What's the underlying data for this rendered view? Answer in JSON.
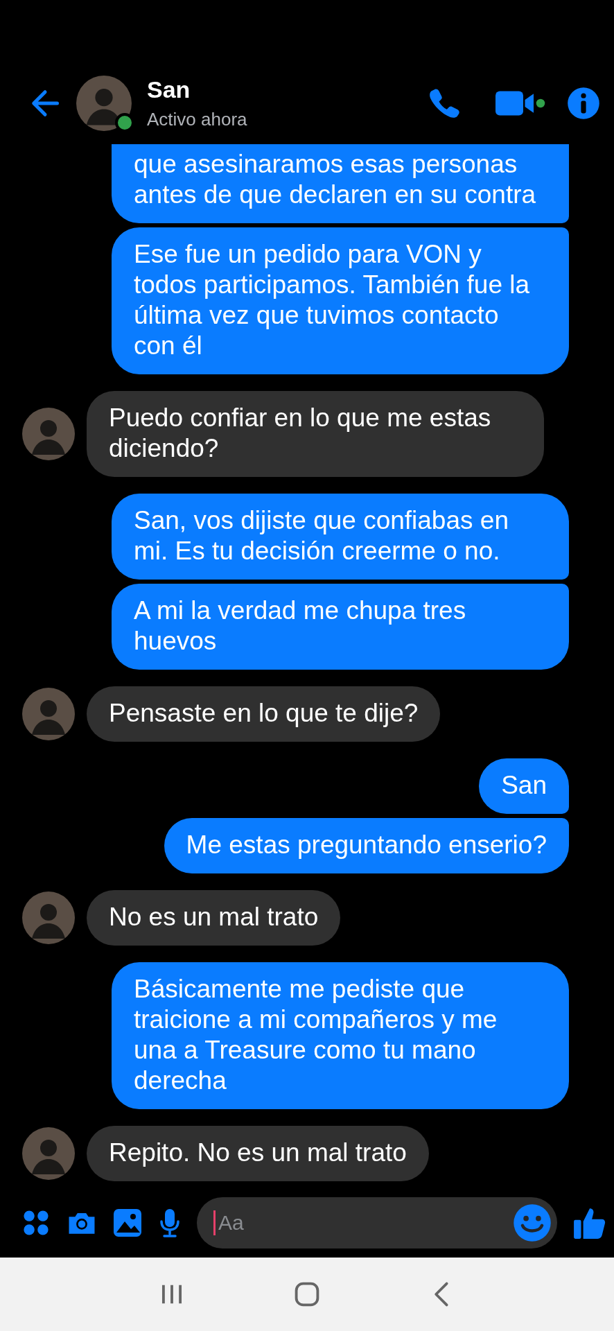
{
  "header": {
    "name": "San",
    "status": "Activo ahora",
    "online": true
  },
  "messages": [
    {
      "kind": "sent",
      "text": "que asesinaramos esas personas antes de que declaren en su contra"
    },
    {
      "kind": "sent",
      "text": "Ese fue un pedido para VON y todos participamos. También fue la última vez que tuvimos contacto con él"
    },
    {
      "kind": "received",
      "text": "Puedo confiar en lo que me estas diciendo?"
    },
    {
      "kind": "sent",
      "text": "San, vos dijiste que confiabas en mi. Es tu decisión creerme o no."
    },
    {
      "kind": "sent",
      "text": "A mi la verdad me chupa tres huevos"
    },
    {
      "kind": "received",
      "text": "Pensaste en lo que te dije?"
    },
    {
      "kind": "sent",
      "text": "San"
    },
    {
      "kind": "sent",
      "text": "Me estas preguntando enserio?"
    },
    {
      "kind": "received",
      "text": "No es un mal trato"
    },
    {
      "kind": "sent",
      "text": "Básicamente me pediste que traicione a mi compañeros y me una a Treasure como tu mano derecha"
    },
    {
      "kind": "received",
      "text": "Repito. No es un mal trato"
    }
  ],
  "composer": {
    "placeholder": "Aa"
  }
}
